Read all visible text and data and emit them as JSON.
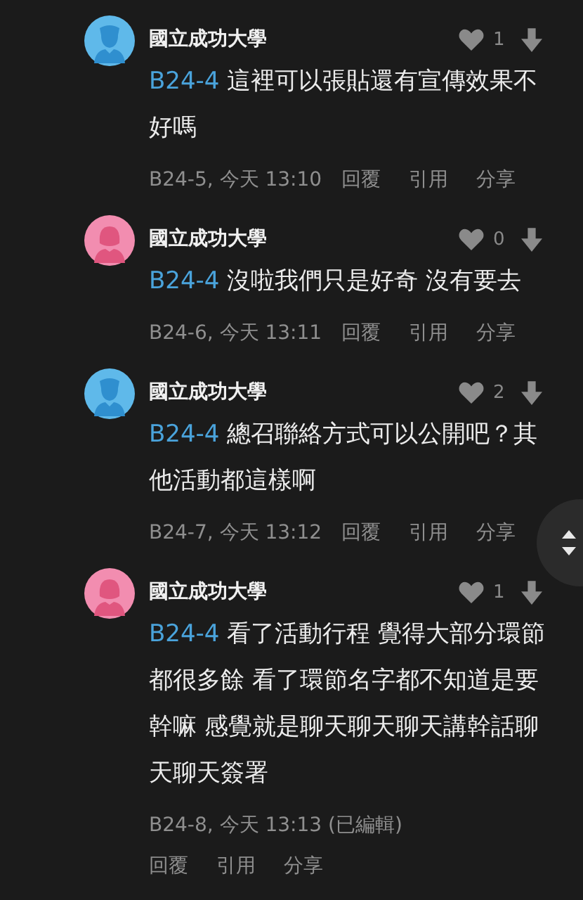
{
  "comments": [
    {
      "kind": "male",
      "color": "#5fb9ea",
      "name": "國立成功大學",
      "likes": "1",
      "reply_to": "B24-4",
      "text": "這裡可以張貼還有宣傳效果不好嗎",
      "floor": "B24-5, 今天 13:10",
      "actions": [
        "回覆",
        "引用",
        "分享"
      ]
    },
    {
      "kind": "female",
      "color": "#f28db0",
      "name": "國立成功大學",
      "likes": "0",
      "reply_to": "B24-4",
      "text": "沒啦我們只是好奇 沒有要去",
      "floor": "B24-6, 今天 13:11",
      "actions": [
        "回覆",
        "引用",
        "分享"
      ]
    },
    {
      "kind": "male",
      "color": "#5fb9ea",
      "name": "國立成功大學",
      "likes": "2",
      "reply_to": "B24-4",
      "text": "總召聯絡方式可以公開吧？其他活動都這樣啊",
      "floor": "B24-7, 今天 13:12",
      "actions": [
        "回覆",
        "引用",
        "分享"
      ]
    },
    {
      "kind": "female",
      "color": "#f28db0",
      "name": "國立成功大學",
      "likes": "1",
      "reply_to": "B24-4",
      "text": "看了活動行程 覺得大部分環節都很多餘 看了環節名字都不知道是要幹嘛 感覺就是聊天聊天聊天講幹話聊天聊天簽署",
      "floor": "B24-8, 今天 13:13 (已編輯)",
      "edited": true,
      "actions": [
        "回覆",
        "引用",
        "分享"
      ]
    }
  ]
}
